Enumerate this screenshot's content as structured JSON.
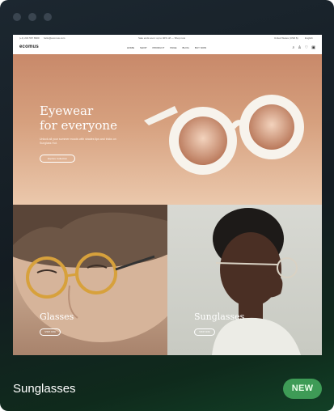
{
  "window": {
    "controls": [
      "close",
      "minimize",
      "maximize"
    ]
  },
  "site": {
    "topbar": {
      "phone": "(+1) 234 567 8900",
      "email": "hello@ecomus.com",
      "promo": "Sale ends soon: up to 40% off — Shop now",
      "currency": "United States (USD $)",
      "language": "English"
    },
    "logo": "ecomus",
    "menu": [
      "HOME",
      "SHOP",
      "PRODUCT",
      "PAGE",
      "BLOG",
      "BUY NOW"
    ],
    "icons": [
      "search-icon",
      "user-icon",
      "heart-icon",
      "bag-icon"
    ],
    "hero": {
      "title_line1": "Eyewear",
      "title_line2": "for everyone",
      "subtitle": "Unlock all your summer moods with shades tips and tricks on Sunglass Hut.",
      "button": "Explore Collection"
    },
    "tiles": [
      {
        "title": "Glasses",
        "button": "SHOP NOW"
      },
      {
        "title": "Sunglasses",
        "button": "SHOP NOW"
      }
    ]
  },
  "caption": "Sunglasses",
  "badge": "NEW",
  "colors": {
    "badge": "#3e9b56",
    "hero_top": "#c8896a",
    "hero_bottom": "#ebc8ac"
  }
}
